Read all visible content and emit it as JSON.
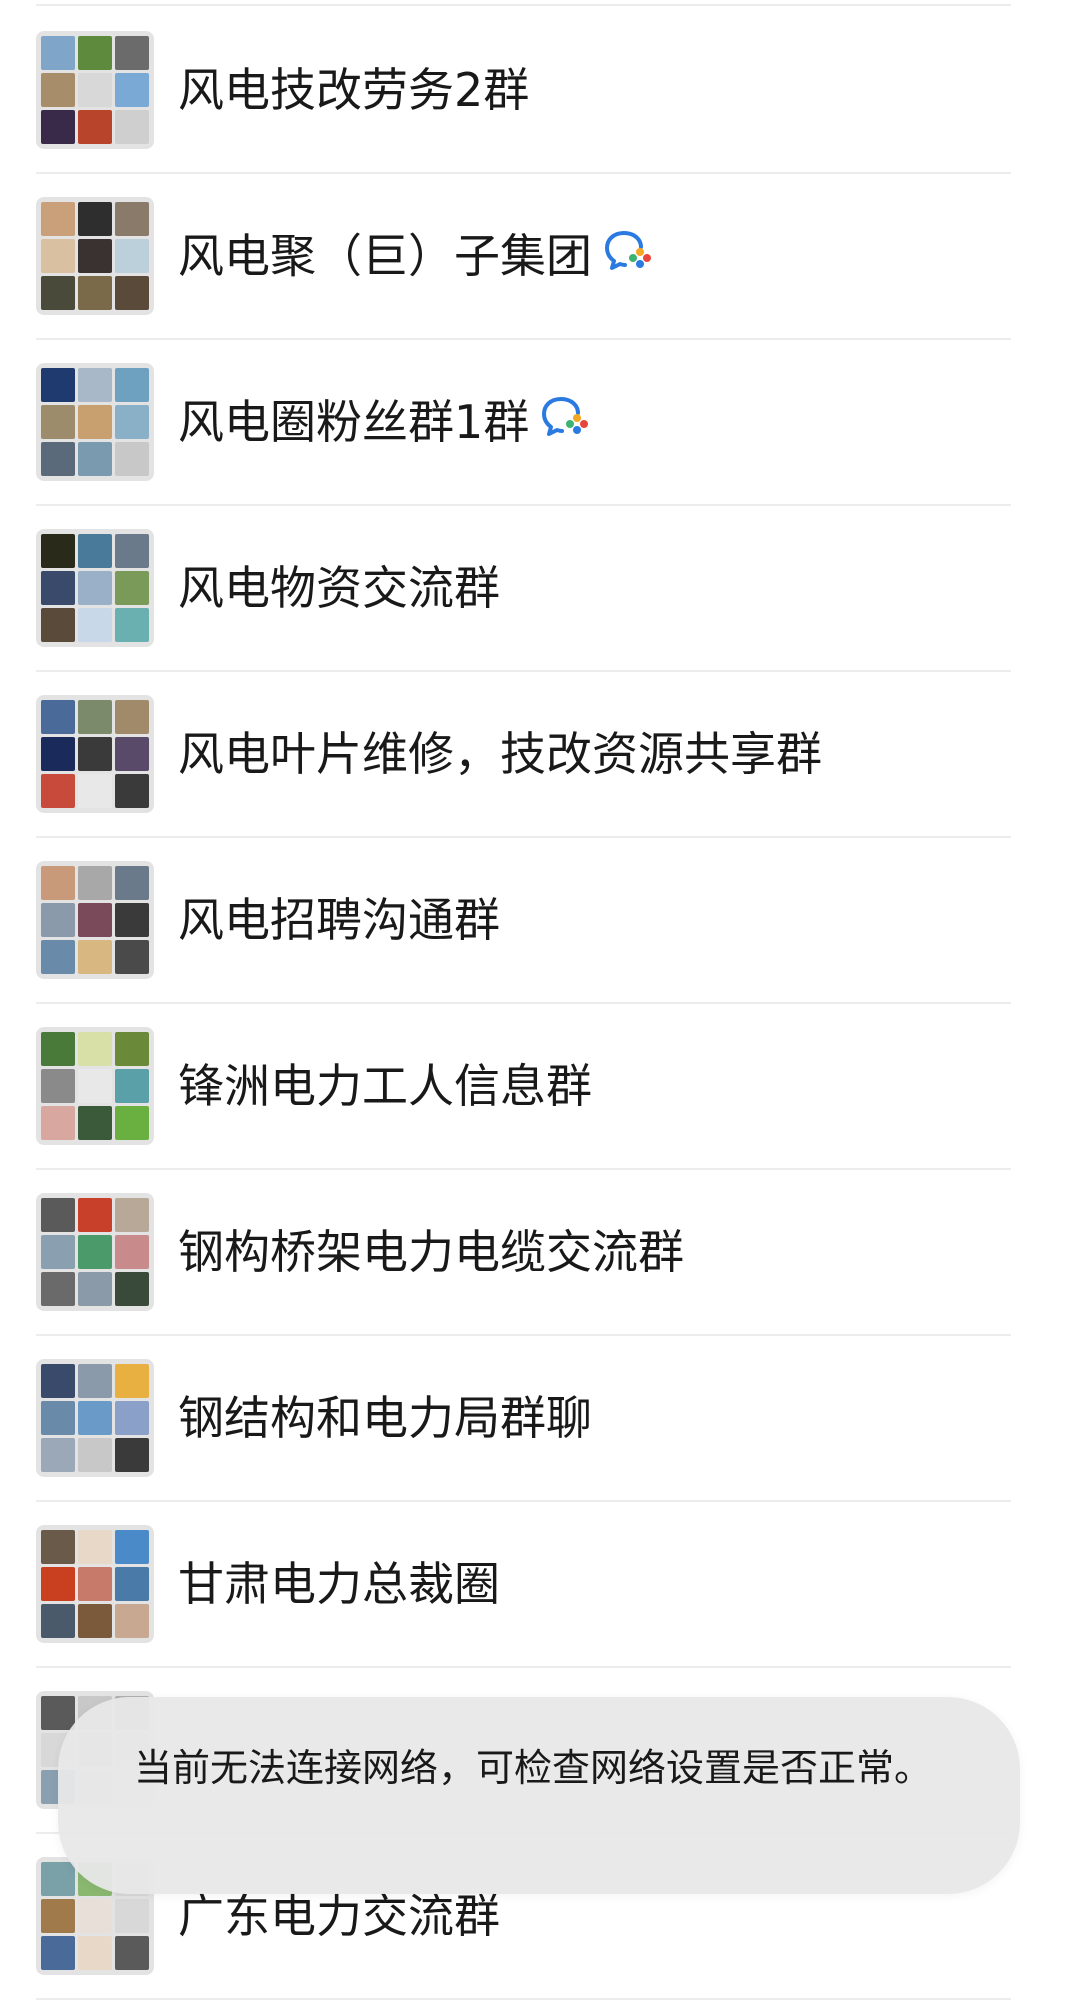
{
  "groups": [
    {
      "name": "风电技改劳务2群",
      "work_badge": false,
      "colors": [
        "#7fa6c8",
        "#5e8a3e",
        "#6b6b6b",
        "#a88d6a",
        "#d8d8d8",
        "#7aa9d6",
        "#3a2a4a",
        "#b8442c",
        "#cfcfcf"
      ]
    },
    {
      "name": "风电聚（巨）子集团",
      "work_badge": true,
      "colors": [
        "#c9a07a",
        "#2e2e2e",
        "#8a7a6a",
        "#d9c0a0",
        "#3a3230",
        "#bcd0dc",
        "#4a4a3a",
        "#7b6a4a",
        "#5a4a3a"
      ]
    },
    {
      "name": "风电圈粉丝群1群",
      "work_badge": true,
      "colors": [
        "#1e3a6e",
        "#a8b8c8",
        "#6ea0c0",
        "#9c8c6c",
        "#c8a070",
        "#8ab0c8",
        "#5a6a7a",
        "#7a9ab0",
        "#c8c8c8"
      ]
    },
    {
      "name": "风电物资交流群",
      "work_badge": false,
      "colors": [
        "#2a2a1a",
        "#4a7a9a",
        "#6a7a8a",
        "#3a4a6a",
        "#9ab0c8",
        "#7a9a5a",
        "#5a4a3a",
        "#c8d8e8",
        "#6ab0b0"
      ]
    },
    {
      "name": "风电叶片维修，技改资源共享群",
      "work_badge": false,
      "colors": [
        "#4a6a9a",
        "#7a8a6a",
        "#a08a6a",
        "#1a2a5a",
        "#3a3a3a",
        "#5a4a6a",
        "#c84a3a",
        "#e8e8e8",
        "#3a3a3a"
      ]
    },
    {
      "name": "风电招聘沟通群",
      "work_badge": false,
      "colors": [
        "#c89a7a",
        "#a8a8a8",
        "#6a7a8a",
        "#8a9aaa",
        "#7a4a5a",
        "#3a3a3a",
        "#6a8aaa",
        "#d8b880",
        "#4a4a4a"
      ]
    },
    {
      "name": "锋洲电力工人信息群",
      "work_badge": false,
      "colors": [
        "#4a7a3a",
        "#d8e0a8",
        "#6a8a3a",
        "#8a8a8a",
        "#e8e8e8",
        "#5aa0a8",
        "#d8a8a0",
        "#3a5a3a",
        "#6ab040"
      ]
    },
    {
      "name": "钢构桥架电力电缆交流群",
      "work_badge": false,
      "colors": [
        "#5a5a5a",
        "#c8402a",
        "#b8a898",
        "#8aa0b0",
        "#4a9a6a",
        "#c88a8a",
        "#6a6a6a",
        "#8a9aa8",
        "#3a4a3a"
      ]
    },
    {
      "name": "钢结构和电力局群聊",
      "work_badge": false,
      "colors": [
        "#3a4a6a",
        "#8a9aaa",
        "#e8b040",
        "#6a8aaa",
        "#6a9ac8",
        "#8aa0c8",
        "#9aa8b8",
        "#c8c8c8",
        "#3a3a3a"
      ]
    },
    {
      "name": "甘肃电力总裁圈",
      "work_badge": false,
      "colors": [
        "#6a5a4a",
        "#e8d8c8",
        "#4a8ac8",
        "#c84020",
        "#c87a6a",
        "#4a7aa8",
        "#4a5a6a",
        "#7a5a3a",
        "#c8a890"
      ]
    },
    {
      "name": "",
      "work_badge": false,
      "colors": [
        "#5a5a5a",
        "#c8c8c8",
        "#b0b0b0",
        "#d8d8d8",
        "#c8c8c8",
        "#d0d0d0",
        "#8aa0b0",
        "#d8d8d8",
        "#e0e0e0"
      ]
    },
    {
      "name": "广东电力交流群",
      "work_badge": false,
      "colors": [
        "#7aa0a8",
        "#8ab870",
        "#d8d8d8",
        "#a07a4a",
        "#e8e0d8",
        "#d8d8d8",
        "#4a6a9a",
        "#e8d8c8",
        "#5a5a5a"
      ]
    }
  ],
  "toast": {
    "message": "当前无法连接网络，可检查网络设置是否正常。"
  }
}
